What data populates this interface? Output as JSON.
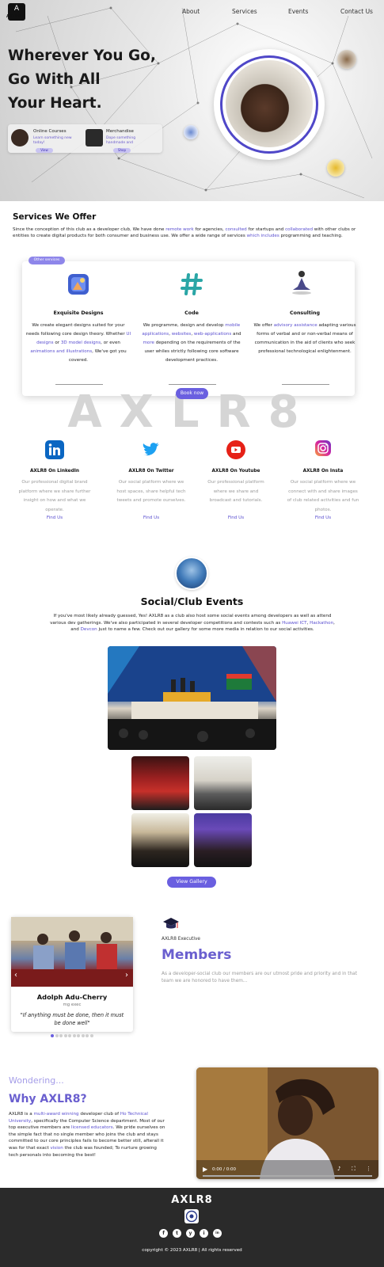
{
  "header": {
    "logo_mark": "A",
    "logo_text": "AXLR8",
    "nav": [
      "About",
      "Services",
      "Events",
      "Contact Us"
    ]
  },
  "hero": {
    "title_lines": [
      "Wherever You Go,",
      "Go With All",
      "Your Heart."
    ],
    "cards": [
      {
        "title": "Online Courses",
        "subtitle": "Learn something new today!",
        "button": "View"
      },
      {
        "title": "Merchandise",
        "subtitle": "Dope something handmade and",
        "button": "Shop"
      }
    ]
  },
  "services": {
    "title": "Services We Offer",
    "desc_parts": [
      "Since the conception of this club as a developer club, We have done ",
      "remote work",
      " for agencies, ",
      "consulted",
      " for startups and ",
      "collaborated",
      " with other clubs or entities to create digital products for both consumer and business use. We offer a wide range of services ",
      "which includes",
      " programming and teaching."
    ],
    "pill": "Other services",
    "items": [
      {
        "name": "Exquisite Designs",
        "text_parts": [
          "We create elegant designs suited for your needs following core design theory. Whether ",
          "UI designs",
          " or ",
          "3D model designs",
          ", or even ",
          "animations and illustrations",
          ", We've got you covered."
        ]
      },
      {
        "name": "Code",
        "text_parts": [
          "We programme, design and develop ",
          "mobile applications",
          ", ",
          "websites",
          ", ",
          "web-applications",
          " and ",
          "more",
          " depending on the requirements of the user whiles strictly following core software development practices."
        ]
      },
      {
        "name": "Consulting",
        "text_parts": [
          "We offer ",
          "advisory assistance",
          " adapting various forms of verbal and or non-verbal means of communication in the aid of clients who seek professional technological enlightenment."
        ]
      }
    ],
    "book_button": "Book now",
    "watermark": "AXLR8"
  },
  "platforms": [
    {
      "name": "AXLR8 On LinkedIn",
      "text": "Our professional digital brand platform where we share further insight on how and what we operate.",
      "link": "Find Us",
      "color": "#0a66c2",
      "icon": "linkedin-icon"
    },
    {
      "name": "AXLR8 On Twitter",
      "text": "Our social platform where we host spaces, share helpful tech tweets and promote ourselves.",
      "link": "Find Us",
      "color": "#1da1f2",
      "icon": "twitter-icon"
    },
    {
      "name": "AXLR8 On Youtube",
      "text": "Our professional platform where we share and broadcast and tutorials.",
      "link": "Find Us",
      "color": "#e62117",
      "icon": "youtube-icon"
    },
    {
      "name": "AXLR8 On Insta",
      "text": "Our social platform where we connect with and share images of club related activities and fun photos.",
      "link": "Find Us",
      "color": "#d6249f",
      "icon": "instagram-icon"
    }
  ],
  "events": {
    "title": "Social/Club Events",
    "desc_parts": [
      "If you've most likely already guessed, Yes! AXLR8 as a club also host some social events among developers as well as attend various dev gatherings. We've also participated in several developer competitions and contests such as ",
      "Huawei ICT",
      ", ",
      "Hackathon",
      ", and ",
      "Devcon",
      " just to name a few. Check out our gallery for some more media in relation to our social activities."
    ],
    "gallery_button": "View Gallery"
  },
  "members": {
    "card": {
      "name": "Adolph Adu-Cherry",
      "role": "mg exec",
      "quote": "If anything must be done, then it must be done well"
    },
    "dots": 10,
    "exec_label": "AXLR8 Executive",
    "title": "Members",
    "desc": "As a developer-social club our members are our utmost pride and priority and in that team we are honored to have them..."
  },
  "why": {
    "pretitle": "Wondering...",
    "title": "Why AXLR8?",
    "desc_parts": [
      "AXLR8 is a ",
      "multi-award winning",
      " developer club of ",
      "Ho Technical University",
      ", specifically the Computer Science department. Most of our top executive members are ",
      "licensed educators",
      ". We pride ourselves on the simple fact that no single member who joins the club and stays committed to our core principles fails to become better still, afterall it was for that exact ",
      "vision",
      " the club was founded; To nurture growing tech personals into becoming the best!"
    ],
    "video_time": "0:00 / 0:00"
  },
  "footer": {
    "title": "AXLR8",
    "social_icons": [
      "f",
      "t",
      "y",
      "i",
      "in"
    ],
    "copyright": "copyright © 2023 AXLR8 | All rights reserved"
  },
  "colors": {
    "accent": "#6a5fe0",
    "footer": "#2a2a2a"
  }
}
